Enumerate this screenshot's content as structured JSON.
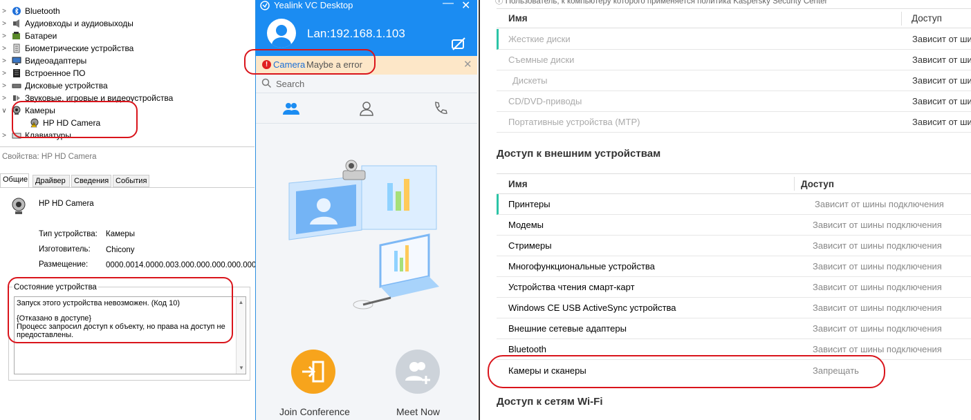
{
  "devmgr": {
    "items": [
      {
        "label": "Bluetooth",
        "icon": "bluetooth-icon",
        "expanded": false
      },
      {
        "label": "Аудиовходы и аудиовыходы",
        "icon": "speaker-icon",
        "expanded": false
      },
      {
        "label": "Батареи",
        "icon": "battery-icon",
        "expanded": false
      },
      {
        "label": "Биометрические устройства",
        "icon": "biometric-icon",
        "expanded": false
      },
      {
        "label": "Видеоадаптеры",
        "icon": "display-adapter-icon",
        "expanded": false
      },
      {
        "label": "Встроенное ПО",
        "icon": "firmware-icon",
        "expanded": false
      },
      {
        "label": "Дисковые устройства",
        "icon": "disk-icon",
        "expanded": false
      },
      {
        "label": "Звуковые, игровые и видеоустройства",
        "icon": "sound-icon",
        "expanded": false
      },
      {
        "label": "Камеры",
        "icon": "camera-icon",
        "expanded": true
      },
      {
        "label": "HP HD Camera",
        "icon": "camera-warning-icon",
        "child": true
      },
      {
        "label": "Клавиатуры",
        "icon": "keyboard-icon",
        "expanded": false
      }
    ]
  },
  "props": {
    "title": "Свойства: HP HD Camera",
    "tabs": [
      "Общие",
      "Драйвер",
      "Сведения",
      "События"
    ],
    "device_name": "HP HD Camera",
    "type_label": "Тип устройства:",
    "type_value": "Камеры",
    "maker_label": "Изготовитель:",
    "maker_value": "Chicony",
    "location_label": "Размещение:",
    "location_value": "0000.0014.0000.003.000.000.000.000.000",
    "status_group": "Состояние устройства",
    "status_line1": "Запуск этого устройства невозможен. (Код 10)",
    "status_line2": "{Отказано в доступе}",
    "status_line3": "Процесс запросил доступ к объекту, но права на доступ не",
    "status_line4": "предоставлены."
  },
  "yealink": {
    "app_title": "Yealink VC Desktop",
    "lan": "Lan:192.168.1.103",
    "warn_camera": "Camera",
    "warn_text": "Maybe a error",
    "search_placeholder": "Search",
    "join_label": "Join Conference",
    "meet_label": "Meet Now",
    "accent": "#1b8cf2"
  },
  "kasp": {
    "top_note": "Пользователь, к компьютеру которого применяется политика Kaspersky Security Center",
    "col_name": "Имя",
    "col_access": "Доступ",
    "storage_rows": [
      {
        "name": "Жесткие диски",
        "access": "Зависит от ши"
      },
      {
        "name": "Съемные диски",
        "access": "Зависит от ши"
      },
      {
        "name": "Дискеты",
        "access": "Зависит от ши"
      },
      {
        "name": "CD/DVD-приводы",
        "access": "Зависит от ши"
      },
      {
        "name": "Портативные устройства (MTP)",
        "access": "Зависит от ши"
      }
    ],
    "ext_title": "Доступ к внешним устройствам",
    "ext_col_name": "Имя",
    "ext_col_access": "Доступ",
    "ext_rows": [
      {
        "name": "Принтеры",
        "access": "Зависит от шины подключения"
      },
      {
        "name": "Модемы",
        "access": "Зависит от шины подключения"
      },
      {
        "name": "Стримеры",
        "access": "Зависит от шины подключения"
      },
      {
        "name": "Многофункциональные устройства",
        "access": "Зависит от шины подключения"
      },
      {
        "name": "Устройства чтения смарт-карт",
        "access": "Зависит от шины подключения"
      },
      {
        "name": "Windows CE USB ActiveSync устройства",
        "access": "Зависит от шины подключения"
      },
      {
        "name": "Внешние сетевые адаптеры",
        "access": "Зависит от шины подключения"
      },
      {
        "name": "Bluetooth",
        "access": "Зависит от шины подключения"
      },
      {
        "name": "Камеры и сканеры",
        "access": "Запрещать"
      }
    ],
    "wifi_title": "Доступ к сетям Wi-Fi"
  }
}
